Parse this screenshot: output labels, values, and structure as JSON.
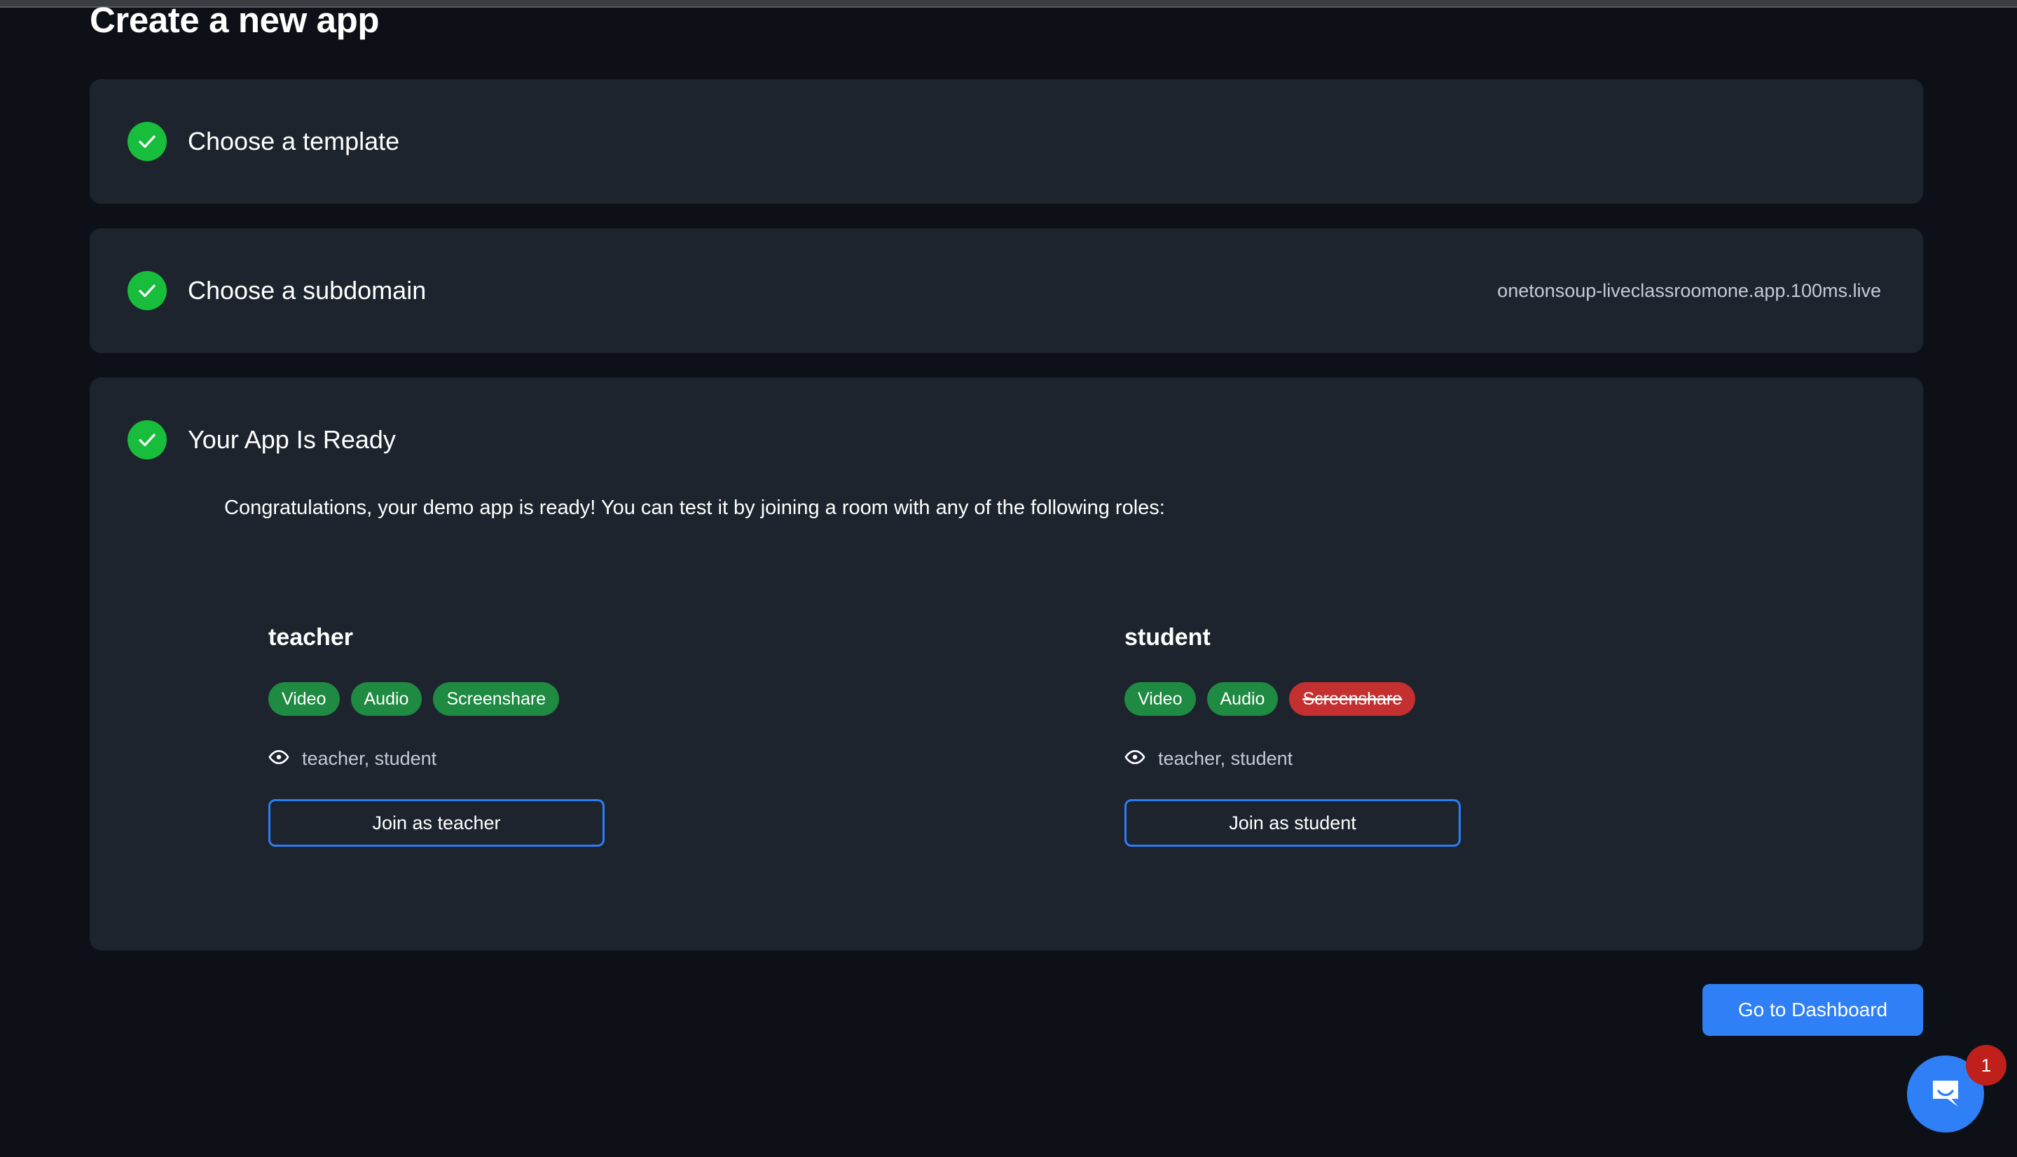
{
  "page": {
    "title": "Create a new app",
    "background_color": "#0d1117",
    "card_color": "#1d242e"
  },
  "steps": [
    {
      "id": "choose-template",
      "title": "Choose a template",
      "status_icon": "check-icon",
      "completed": true,
      "value": ""
    },
    {
      "id": "choose-subdomain",
      "title": "Choose a subdomain",
      "status_icon": "check-icon",
      "completed": true,
      "value": "onetonsoup-liveclassroomone.app.100ms.live"
    },
    {
      "id": "app-ready",
      "title": "Your App Is Ready",
      "status_icon": "check-icon",
      "completed": true,
      "description": "Congratulations, your demo app is ready! You can test it by joining a room with any of the following roles:"
    }
  ],
  "roles": [
    {
      "name": "teacher",
      "permissions": [
        {
          "label": "Video",
          "enabled": true
        },
        {
          "label": "Audio",
          "enabled": true
        },
        {
          "label": "Screenshare",
          "enabled": true
        }
      ],
      "viewers_icon": "eye-icon",
      "viewers": "teacher, student",
      "join_label": "Join as teacher"
    },
    {
      "name": "student",
      "permissions": [
        {
          "label": "Video",
          "enabled": true
        },
        {
          "label": "Audio",
          "enabled": true
        },
        {
          "label": "Screenshare",
          "enabled": false
        }
      ],
      "viewers_icon": "eye-icon",
      "viewers": "teacher, student",
      "join_label": "Join as student"
    }
  ],
  "footer": {
    "dashboard_label": "Go to Dashboard"
  },
  "intercom": {
    "icon": "chat-bubble-icon",
    "badge_count": "1"
  },
  "colors": {
    "accent_blue": "#2f7ff6",
    "success_green": "#18bd3c",
    "pill_green": "#1f8a42",
    "pill_red": "#c43030",
    "badge_red": "#c0201c",
    "muted_text": "#c2cbd8"
  }
}
